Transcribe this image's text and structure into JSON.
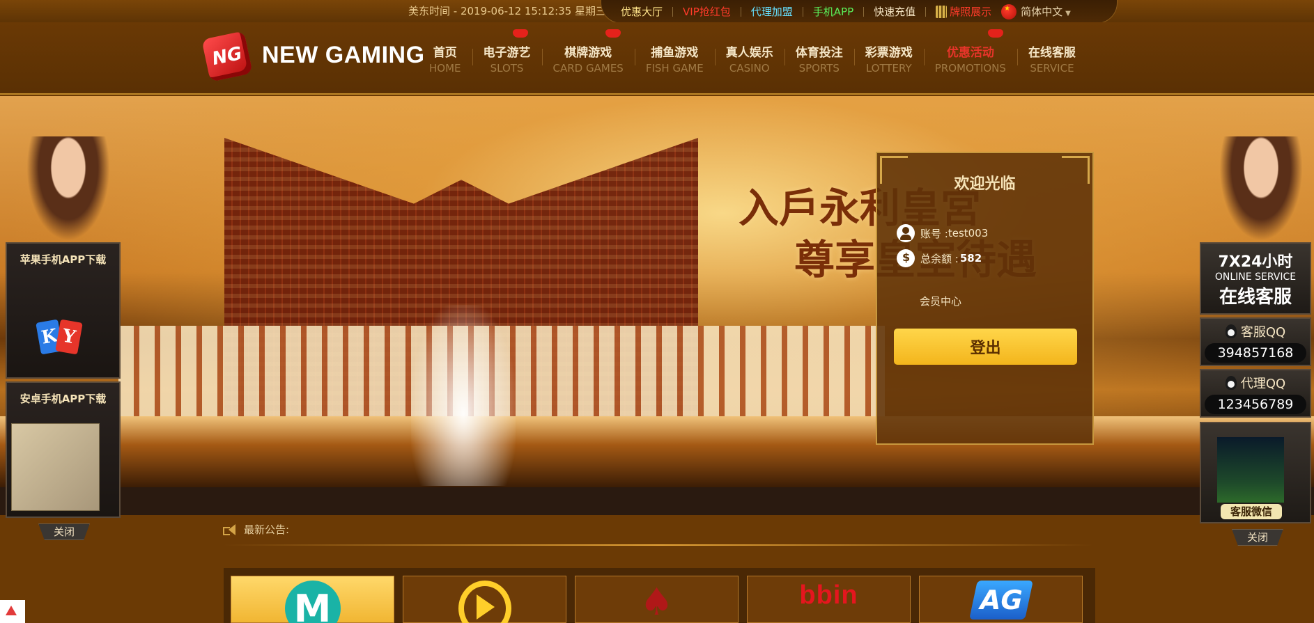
{
  "topbar": {
    "clock": "美东时间 - 2019-06-12 15:12:35 星期三",
    "links": [
      {
        "label": "优惠大厅",
        "color": "#ffe48a"
      },
      {
        "label": "VIP抢红包",
        "color": "#ff3b2a"
      },
      {
        "label": "代理加盟",
        "color": "#66e0ff"
      },
      {
        "label": "手机APP",
        "color": "#5af05a"
      },
      {
        "label": "快速充值",
        "color": "#f4e3c2"
      },
      {
        "label": "牌照展示",
        "color": "#ff3b2a"
      }
    ],
    "language": "简体中文"
  },
  "brand": {
    "dice_text": "NG",
    "name": "NEW GAMING"
  },
  "nav": [
    {
      "cn": "首页",
      "en": "HOME",
      "hot": false,
      "promo": false
    },
    {
      "cn": "电子游艺",
      "en": "SLOTS",
      "hot": true,
      "promo": false
    },
    {
      "cn": "棋牌游戏",
      "en": "CARD GAMES",
      "hot": true,
      "promo": false
    },
    {
      "cn": "捕鱼游戏",
      "en": "FISH GAME",
      "hot": false,
      "promo": false
    },
    {
      "cn": "真人娱乐",
      "en": "CASINO",
      "hot": false,
      "promo": false
    },
    {
      "cn": "体育投注",
      "en": "SPORTS",
      "hot": false,
      "promo": false
    },
    {
      "cn": "彩票游戏",
      "en": "LOTTERY",
      "hot": false,
      "promo": false
    },
    {
      "cn": "优惠活动",
      "en": "PROMOTIONS",
      "hot": true,
      "promo": true
    },
    {
      "cn": "在线客服",
      "en": "SERVICE",
      "hot": false,
      "promo": false
    }
  ],
  "banner": {
    "slogan_line1": "入戶永利皇宮",
    "slogan_line2": "尊享皇室待遇"
  },
  "login_panel": {
    "welcome": "欢迎光临",
    "account_label": "账号 : ",
    "account_value": "test003",
    "balance_label": "总余额 : ",
    "balance_value": "582",
    "member_center": "会员中心",
    "logout": "登出"
  },
  "left_float": {
    "ios_title": "苹果手机APP下载",
    "android_title": "安卓手机APP下载",
    "close": "关闭"
  },
  "right_float": {
    "service_line1": "7X24小时",
    "service_line2": "ONLINE SERVICE",
    "service_line3": "在线客服",
    "qq_service_label": "客服QQ",
    "qq_service_number": "394857168",
    "qq_agent_label": "代理QQ",
    "qq_agent_number": "123456789",
    "wechat_label": "客服微信",
    "close": "关闭"
  },
  "notice": {
    "label": "最新公告:"
  },
  "game_logos": {
    "microgaming": "M",
    "bbin": "bbin",
    "ag": "AG"
  },
  "colors": {
    "accent_gold": "#f3b51c",
    "promo_red": "#e8342a",
    "header_brown": "#5a3004"
  }
}
